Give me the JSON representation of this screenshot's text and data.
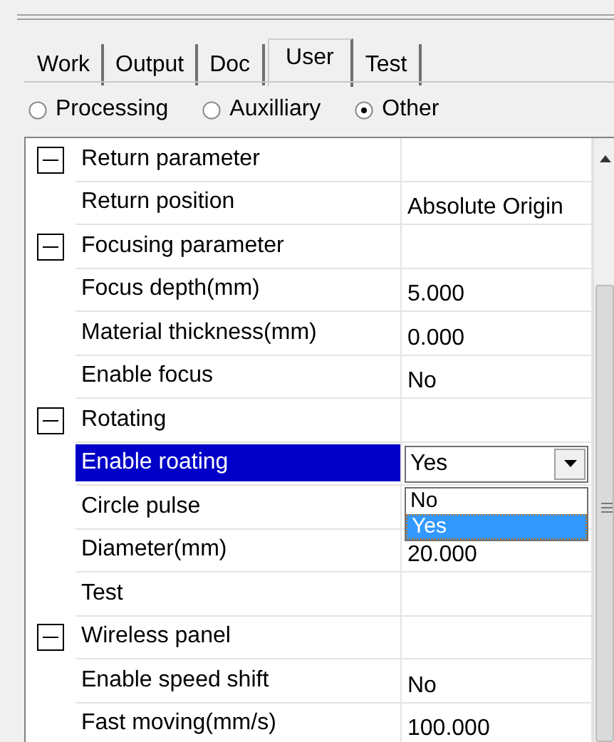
{
  "tabs": [
    {
      "label": "Work",
      "selected": false
    },
    {
      "label": "Output",
      "selected": false
    },
    {
      "label": "Doc",
      "selected": false
    },
    {
      "label": "User",
      "selected": true
    },
    {
      "label": "Test",
      "selected": false
    }
  ],
  "radios": [
    {
      "label": "Processing",
      "selected": false
    },
    {
      "label": "Auxilliary",
      "selected": false
    },
    {
      "label": "Other",
      "selected": true
    }
  ],
  "grid": {
    "groups": [
      {
        "label": "Return parameter",
        "expanded": true,
        "children": [
          {
            "label": "Return position",
            "value": "Absolute Origin",
            "selected": false
          }
        ]
      },
      {
        "label": "Focusing parameter",
        "expanded": true,
        "children": [
          {
            "label": "Focus depth(mm)",
            "value": "5.000",
            "selected": false
          },
          {
            "label": "Material thickness(mm)",
            "value": "0.000",
            "selected": false
          },
          {
            "label": "Enable focus",
            "value": "No",
            "selected": false
          }
        ]
      },
      {
        "label": "Rotating",
        "expanded": true,
        "children": [
          {
            "label": "Enable roating",
            "selected": true,
            "dropdown": {
              "value": "Yes",
              "options": [
                {
                  "label": "No",
                  "selected": false
                },
                {
                  "label": "Yes",
                  "selected": true
                }
              ]
            }
          },
          {
            "label": "Circle pulse",
            "selected": false
          },
          {
            "label": "Diameter(mm)",
            "value": "20.000",
            "selected": false
          },
          {
            "label": "Test",
            "selected": false
          }
        ]
      },
      {
        "label": "Wireless panel",
        "expanded": true,
        "children": [
          {
            "label": "Enable speed shift",
            "value": "No",
            "selected": false
          },
          {
            "label": "Fast moving(mm/s)",
            "value": "100.000",
            "selected": false
          }
        ]
      }
    ]
  }
}
